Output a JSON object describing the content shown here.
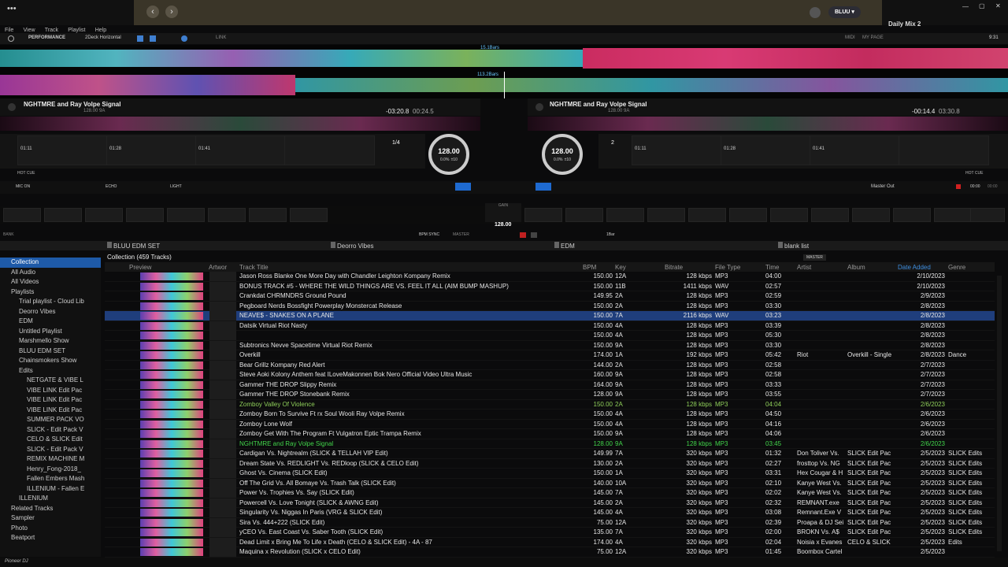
{
  "window": {
    "right_title": "Daily Mix 2",
    "user": "BLUU"
  },
  "menu": [
    "File",
    "View",
    "Track",
    "Playlist",
    "Help"
  ],
  "toolbar": {
    "mode": "PERFORMANCE",
    "layout": "2Deck Horizontal",
    "link": "LINK",
    "midi": "MIDI",
    "mypage": "MY PAGE",
    "clock": "9:31"
  },
  "wave": {
    "bars1": "15.1Bars",
    "bars2": "113.2Bars"
  },
  "decks": [
    {
      "title": "NGHTMRE and Ray Volpe Signal",
      "bpm_key": "128.00 9A",
      "remain": "-03:20.8",
      "elapsed": "00:24.5",
      "jog_bpm": "128.00",
      "jog_pct": "0.0%",
      "jog_range": "±10",
      "loop": "1/4",
      "cues": [
        "01:11",
        "01:28",
        "01:41"
      ]
    },
    {
      "title": "NGHTMRE and Ray Volpe Signal",
      "bpm_key": "128.00 9A",
      "remain": "-00:14.4",
      "elapsed": "03:30.8",
      "jog_bpm": "128.00",
      "jog_pct": "0.0%",
      "jog_range": "±10",
      "loop": "2",
      "cues": [
        "01:11",
        "01:28",
        "01:41"
      ]
    }
  ],
  "fx": {
    "mic": "MIC ON",
    "echo": "ECHO",
    "light": "LIGHT",
    "master_out": "Master Out",
    "time1": "00:00",
    "time2": "00:00",
    "hot_cue": "HOT CUE"
  },
  "center": {
    "bpm": "128.00",
    "bpm_sync": "BPM SYNC",
    "master": "MASTER",
    "bar": "1Bar",
    "bank": "BANK"
  },
  "browser": {
    "panes": [
      "BLUU EDM SET",
      "Deorro Vibes",
      "EDM",
      "blank list"
    ],
    "collection_label": "Collection (459 Tracks)",
    "master_btn": "MASTER"
  },
  "sidebar": [
    "Collection",
    "All Audio",
    "All Videos",
    "Playlists",
    "Trial playlist - Cloud Lib",
    "Deorro Vibes",
    "EDM",
    "Untitled Playlist",
    "Marshmello Show",
    "BLUU EDM SET",
    "Chainsmokers Show",
    "Edits",
    "NETGATE & VIBE L",
    "VIBE LINK Edit Pac",
    "VIBE LINK Edit Pac",
    "VIBE LINK Edit Pac",
    "SUMMER PACK VO",
    "SLICK - Edit Pack V",
    "CELO & SLICK Edit",
    "SLICK - Edit Pack V",
    "REMIX MACHINE M",
    "Henry_Fong-2018_",
    "Fallen Embers Mash",
    "ILLENIUM - Fallen E",
    "ILLENIUM",
    "Related Tracks",
    "Sampler",
    "Photo",
    "Beatport"
  ],
  "columns": [
    "Preview",
    "Artwor",
    "Track Title",
    "BPM",
    "Key",
    "Bitrate",
    "File Type",
    "Time",
    "Artist",
    "Album",
    "Date Added",
    "Genre"
  ],
  "rows": [
    [
      "Jason Ross Blanke One More Day with Chandler Leighton Kompany Remix",
      "150.00",
      "12A",
      "128 kbps",
      "MP3",
      "04:00",
      "",
      "",
      "2/10/2023",
      ""
    ],
    [
      "BONUS TRACK #5 - WHERE THE WILD THINGS ARE VS. FEEL IT ALL (AIM BUMP MASHUP)",
      "150.00",
      "11B",
      "1411 kbps",
      "WAV",
      "02:57",
      "",
      "",
      "2/10/2023",
      ""
    ],
    [
      "Crankdat CHRMNDRS Ground Pound",
      "149.95",
      "2A",
      "128 kbps",
      "MP3",
      "02:59",
      "",
      "",
      "2/9/2023",
      ""
    ],
    [
      "Pegboard Nerds Bossfight Powerplay Monstercat Release",
      "150.00",
      "2A",
      "128 kbps",
      "MP3",
      "03:30",
      "",
      "",
      "2/8/2023",
      ""
    ],
    [
      "NEAVE$ - SNAKES ON A PLANE",
      "150.00",
      "7A",
      "2116 kbps",
      "WAV",
      "03:23",
      "",
      "",
      "2/8/2023",
      ""
    ],
    [
      "Datsik Virtual Riot Nasty",
      "150.00",
      "4A",
      "128 kbps",
      "MP3",
      "03:39",
      "",
      "",
      "2/8/2023",
      ""
    ],
    [
      "",
      "150.00",
      "4A",
      "128 kbps",
      "MP3",
      "05:30",
      "",
      "",
      "2/8/2023",
      ""
    ],
    [
      "Subtronics Nevve Spacetime Virtual Riot Remix",
      "150.00",
      "9A",
      "128 kbps",
      "MP3",
      "03:30",
      "",
      "",
      "2/8/2023",
      ""
    ],
    [
      "Overkill",
      "174.00",
      "1A",
      "192 kbps",
      "MP3",
      "05:42",
      "Riot",
      "Overkill - Single",
      "2/8/2023",
      "Dance"
    ],
    [
      "Bear Grillz Kompany Red Alert",
      "144.00",
      "2A",
      "128 kbps",
      "MP3",
      "02:58",
      "",
      "",
      "2/7/2023",
      ""
    ],
    [
      "Steve Aoki Kolony Anthem feat ILoveMakonnen Bok Nero Official Video Ultra Music",
      "160.00",
      "9A",
      "128 kbps",
      "MP3",
      "02:58",
      "",
      "",
      "2/7/2023",
      ""
    ],
    [
      "Gammer THE DROP Slippy Remix",
      "164.00",
      "9A",
      "128 kbps",
      "MP3",
      "03:33",
      "",
      "",
      "2/7/2023",
      ""
    ],
    [
      "Gammer THE DROP Stonebank Remix",
      "128.00",
      "9A",
      "128 kbps",
      "MP3",
      "03:55",
      "",
      "",
      "2/7/2023",
      ""
    ],
    [
      "Zomboy Valley Of Violence",
      "150.00",
      "2A",
      "128 kbps",
      "MP3",
      "04:04",
      "",
      "",
      "2/6/2023",
      ""
    ],
    [
      "Zomboy Born To Survive Ft rx Soul Wooli Ray Volpe Remix",
      "150.00",
      "4A",
      "128 kbps",
      "MP3",
      "04:50",
      "",
      "",
      "2/6/2023",
      ""
    ],
    [
      "Zomboy Lone Wolf",
      "150.00",
      "4A",
      "128 kbps",
      "MP3",
      "04:16",
      "",
      "",
      "2/6/2023",
      ""
    ],
    [
      "Zomboy Get With The Program Ft Vulgatron Eptic Trampa Remix",
      "150.00",
      "9A",
      "128 kbps",
      "MP3",
      "04:06",
      "",
      "",
      "2/6/2023",
      ""
    ],
    [
      "NGHTMRE and Ray Volpe Signal",
      "128.00",
      "9A",
      "128 kbps",
      "MP3",
      "03:45",
      "",
      "",
      "2/6/2023",
      ""
    ],
    [
      "Cardigan Vs. Nightrealm (SLICK & TELLAH VIP Edit)",
      "149.99",
      "7A",
      "320 kbps",
      "MP3",
      "01:32",
      "Don Toliver Vs.",
      "SLICK Edit Pac",
      "2/5/2023",
      "SLICK Edits"
    ],
    [
      "Dream State Vs. REDLIGHT Vs. REDloop (SLICK & CELO Edit)",
      "130.00",
      "2A",
      "320 kbps",
      "MP3",
      "02:27",
      "frosttop Vs. NG",
      "SLICK Edit Pac",
      "2/5/2023",
      "SLICK Edits"
    ],
    [
      "Ghost Vs. Cinema (SLICK Edit)",
      "150.00",
      "1A",
      "320 kbps",
      "MP3",
      "03:31",
      "Hex Cougar & H",
      "SLICK Edit Pac",
      "2/5/2023",
      "SLICK Edits"
    ],
    [
      "Off The Grid Vs. All Bomaye Vs. Trash Talk (SLICK Edit)",
      "140.00",
      "10A",
      "320 kbps",
      "MP3",
      "02:10",
      "Kanye West Vs.",
      "SLICK Edit Pac",
      "2/5/2023",
      "SLICK Edits"
    ],
    [
      "Power Vs. Trophies Vs. Say (SLICK Edit)",
      "145.00",
      "7A",
      "320 kbps",
      "MP3",
      "02:02",
      "Kanye West Vs.",
      "SLICK Edit Pac",
      "2/5/2023",
      "SLICK Edits"
    ],
    [
      "Powercell Vs. Love Tonight (SLICK & AWNG Edit)",
      "145.00",
      "2A",
      "320 kbps",
      "MP3",
      "02:32",
      "REMNANT.exe",
      "SLICK Edit Pac",
      "2/5/2023",
      "SLICK Edits"
    ],
    [
      "Singularity Vs. Niggas In Paris (VRG & SLICK Edit)",
      "145.00",
      "4A",
      "320 kbps",
      "MP3",
      "03:08",
      "Remnant.Exe V",
      "SLICK Edit Pac",
      "2/5/2023",
      "SLICK Edits"
    ],
    [
      "Sira Vs. 444+222 (SLICK Edit)",
      "75.00",
      "12A",
      "320 kbps",
      "MP3",
      "02:39",
      "Proapa & DJ Sei",
      "SLICK Edit Pac",
      "2/5/2023",
      "SLICK Edits"
    ],
    [
      "yCEO Vs. East Coast Vs. Saber Tooth (SLICK Edit)",
      "135.00",
      "7A",
      "320 kbps",
      "MP3",
      "02:00",
      "BROKN Vs. A$",
      "SLICK Edit Pac",
      "2/5/2023",
      "SLICK Edits"
    ],
    [
      "Dead Limit x Bring Me To Life x Death (CELO & SLICK Edit) - 4A - 87",
      "174.00",
      "4A",
      "320 kbps",
      "MP3",
      "02:04",
      "Noisia x Evanes",
      "CELO & SLICK",
      "2/5/2023",
      "Edits"
    ],
    [
      "Maquina x Revolution (SLICK x CELO Edit)",
      "75.00",
      "12A",
      "320 kbps",
      "MP3",
      "01:45",
      "Boombox Cartel",
      "",
      "2/5/2023",
      ""
    ]
  ],
  "colors": {
    "accent": "#1e5aa8",
    "highlight": "#1f3e7c",
    "green_text": "#42d64b",
    "wave_red": "#e0306a",
    "wave_cyan": "#3fc7d8"
  },
  "footer": "Pioneer DJ"
}
